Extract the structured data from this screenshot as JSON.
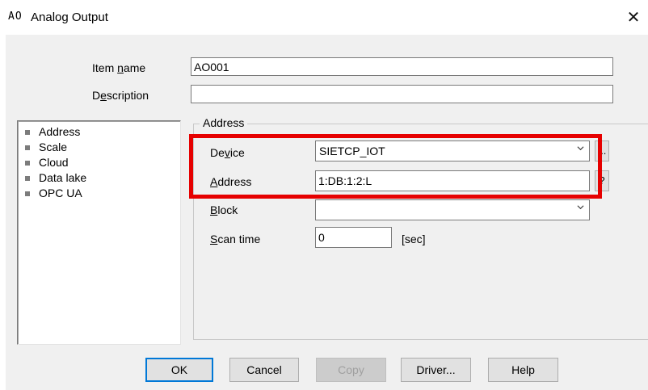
{
  "window": {
    "icon_text": "AO",
    "title": "Analog Output",
    "close_glyph": "✕"
  },
  "fields": {
    "item_name_label": "Item name",
    "item_name_value": "AO001",
    "description_label": "Description",
    "description_value": ""
  },
  "nav": {
    "items": [
      {
        "label": "Address"
      },
      {
        "label": "Scale"
      },
      {
        "label": "Cloud"
      },
      {
        "label": "Data lake"
      },
      {
        "label": "OPC UA"
      }
    ]
  },
  "address_group": {
    "title": "Address",
    "device_label": "Device",
    "device_value": "SIETCP_IOT",
    "device_btn": "...",
    "address_label": "Address",
    "address_value": "1:DB:1:2:L",
    "address_btn": "?",
    "block_label": "Block",
    "block_value": "",
    "scan_time_label": "Scan time",
    "scan_time_value": "0",
    "scan_time_unit": "[sec]"
  },
  "buttons": {
    "ok": "OK",
    "cancel": "Cancel",
    "copy": "Copy",
    "driver": "Driver...",
    "help": "Help"
  },
  "colors": {
    "highlight": "#e60000",
    "dialog_bg": "#f0f0f0",
    "default_button_border": "#0078d7"
  }
}
